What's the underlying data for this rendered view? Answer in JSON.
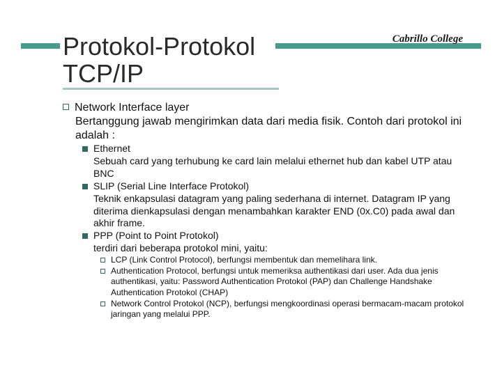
{
  "brand": "Cabrillo College",
  "title_line1": "Protokol-Protokol",
  "title_line2": "TCP/IP",
  "l1": {
    "head": "Network Interface layer",
    "body": "Bertanggung jawab mengirimkan data dari media fisik. Contoh dari protokol ini adalah :"
  },
  "l2": [
    {
      "head": "Ethernet",
      "body": "Sebuah card yang terhubung ke card lain melalui ethernet hub dan kabel UTP atau BNC"
    },
    {
      "head": "SLIP (Serial Line Interface Protokol)",
      "body": "Teknik enkapsulasi datagram yang paling sederhana di internet. Datagram IP yang diterima dienkapsulasi dengan menambahkan karakter END (0x.C0) pada awal dan akhir frame."
    },
    {
      "head": "PPP (Point to Point Protokol)",
      "body": "terdiri dari beberapa protokol mini, yaitu:"
    }
  ],
  "l3": [
    {
      "txt": "LCP (Link Control Protocol), berfungsi membentuk dan memelihara link."
    },
    {
      "txt": "Authentication Protocol, berfungsi untuk memeriksa authentikasi dari user. Ada dua jenis authentikasi, yaitu: Password Authentication Protokol (PAP) dan Challenge Handshake Authentication Protokol (CHAP)"
    },
    {
      "txt": "Network Control Protokol (NCP), berfungsi mengkoordinasi operasi bermacam-macam protokol jaringan yang melalui PPP."
    }
  ]
}
